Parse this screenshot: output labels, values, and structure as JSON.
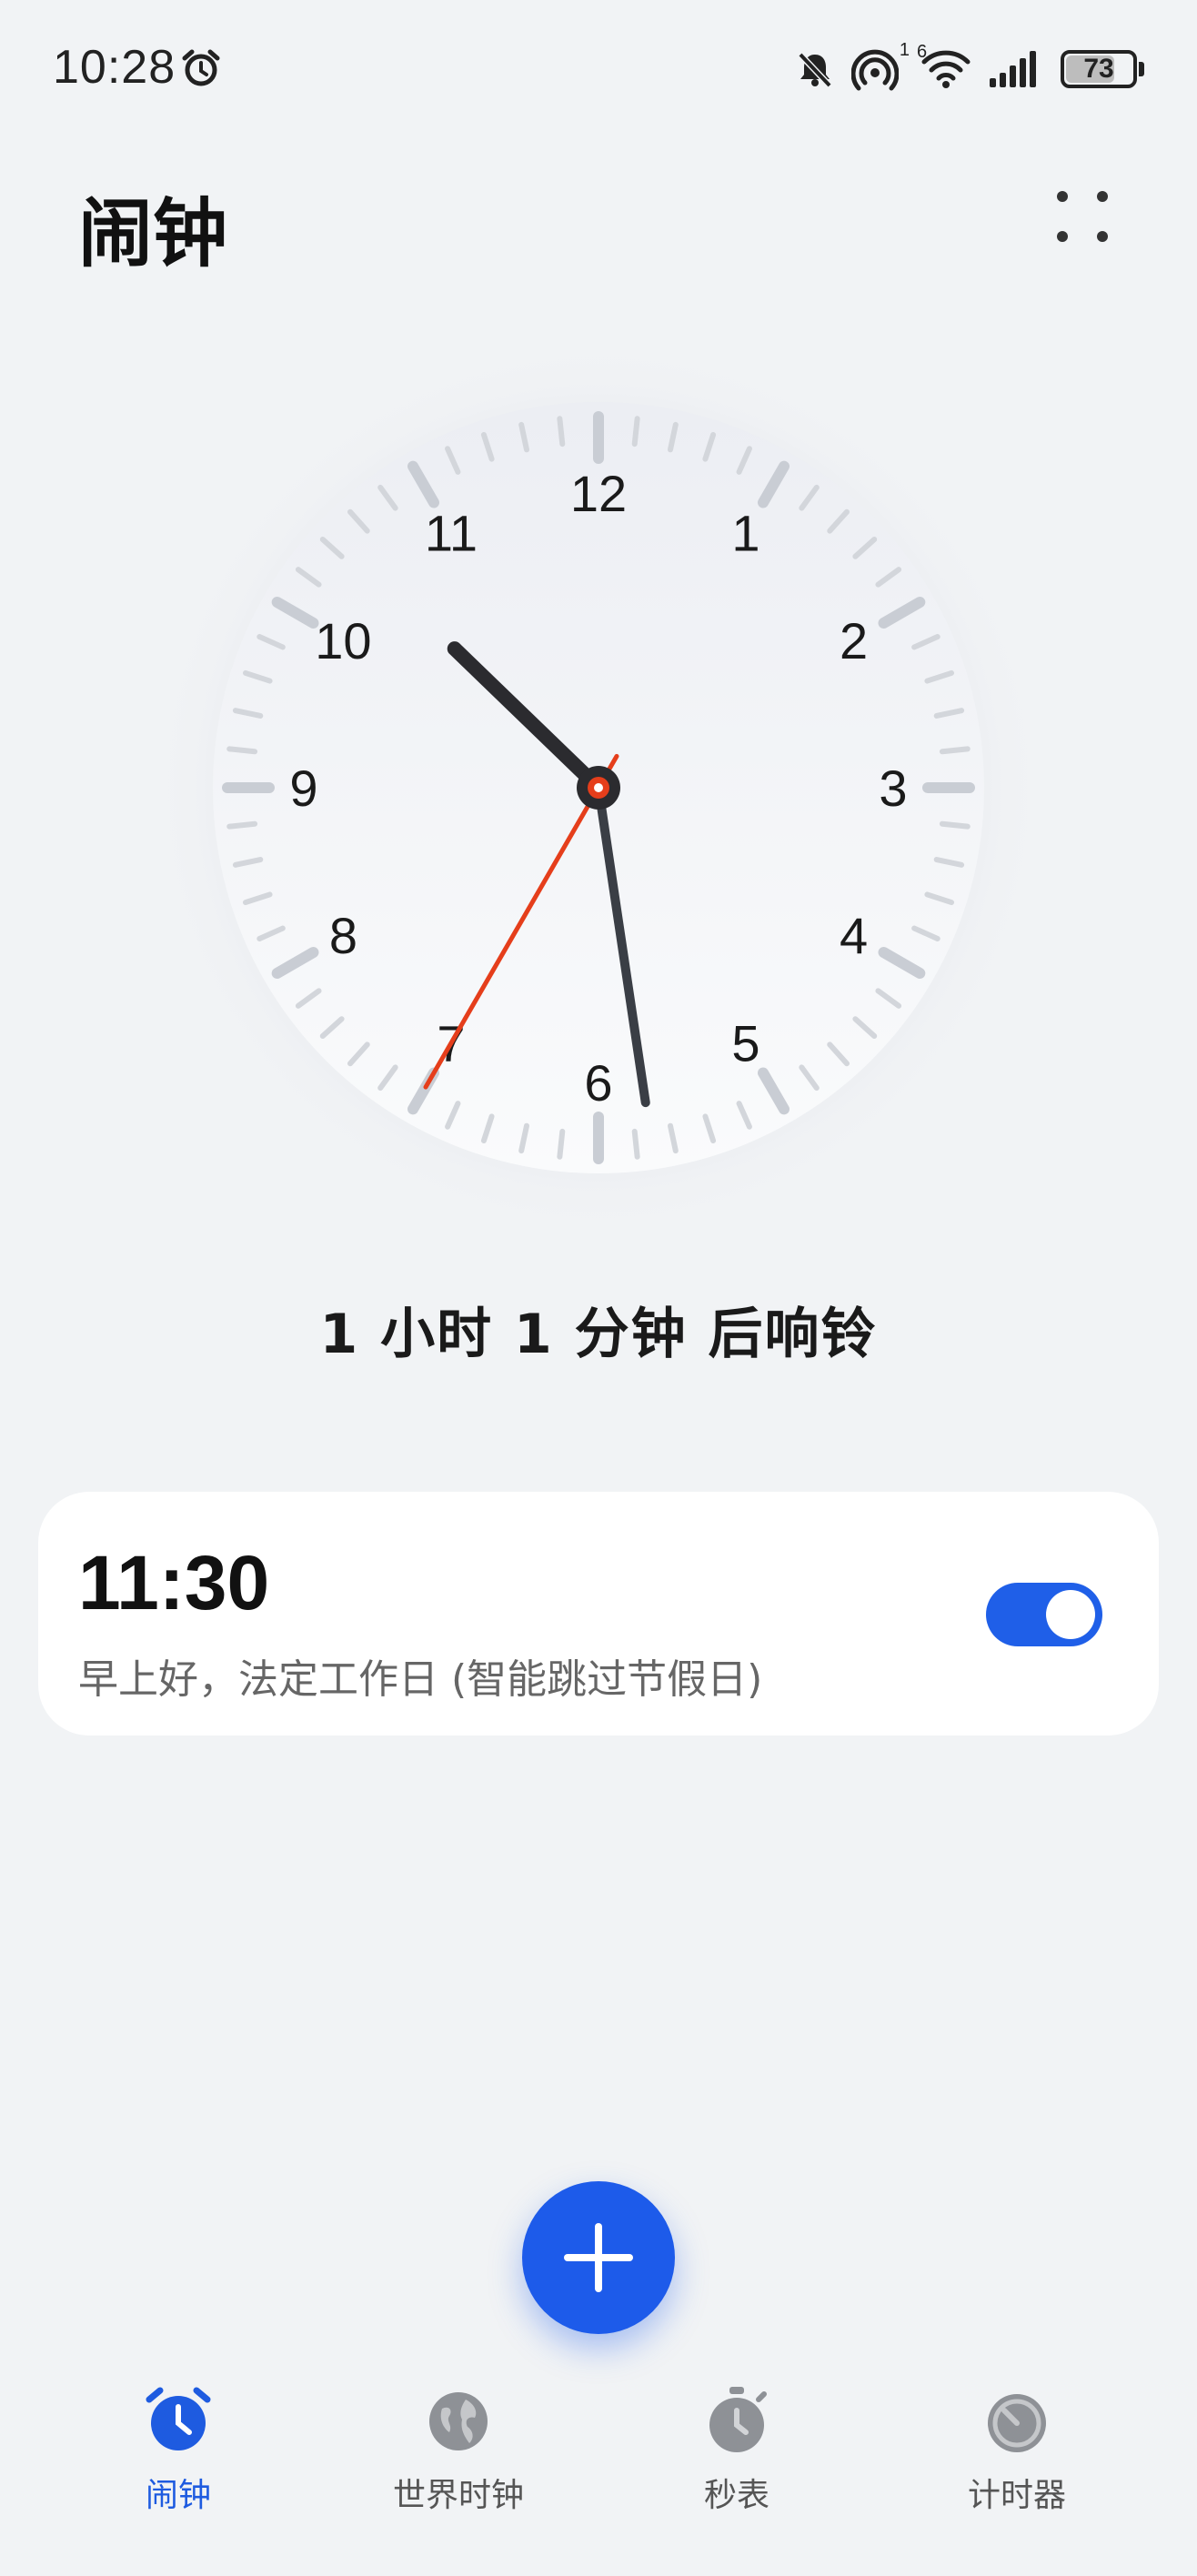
{
  "status_bar": {
    "time": "10:28",
    "battery_level": "73",
    "icons": [
      "alarm-clock-icon",
      "bell-off-icon",
      "hotspot-icon",
      "wifi-icon",
      "signal-icon",
      "battery-icon"
    ],
    "hotspot_badge": "1",
    "wifi_badge": "6"
  },
  "header": {
    "title": "闹钟"
  },
  "clock": {
    "numerals": [
      "12",
      "1",
      "2",
      "3",
      "4",
      "5",
      "6",
      "7",
      "8",
      "9",
      "10",
      "11"
    ],
    "time": {
      "hour": 10,
      "minute": 28,
      "second": 35
    },
    "colors": {
      "hour_hand": "#2B2B2F",
      "minute_hand": "#3A3E45",
      "second_hand": "#E53E1B"
    }
  },
  "countdown": "1 小时 1 分钟 后响铃",
  "alarms": [
    {
      "time": "11:30",
      "label": "早上好，法定工作日 (智能跳过节假日)",
      "enabled": true
    }
  ],
  "colors": {
    "background": "#F1F3F5",
    "accent": "#1D5BEA",
    "card": "#FFFFFF"
  },
  "nav": [
    {
      "label": "闹钟",
      "icon": "alarm-clock-icon",
      "active": true
    },
    {
      "label": "世界时钟",
      "icon": "globe-icon",
      "active": false
    },
    {
      "label": "秒表",
      "icon": "stopwatch-icon",
      "active": false
    },
    {
      "label": "计时器",
      "icon": "timer-icon",
      "active": false
    }
  ]
}
